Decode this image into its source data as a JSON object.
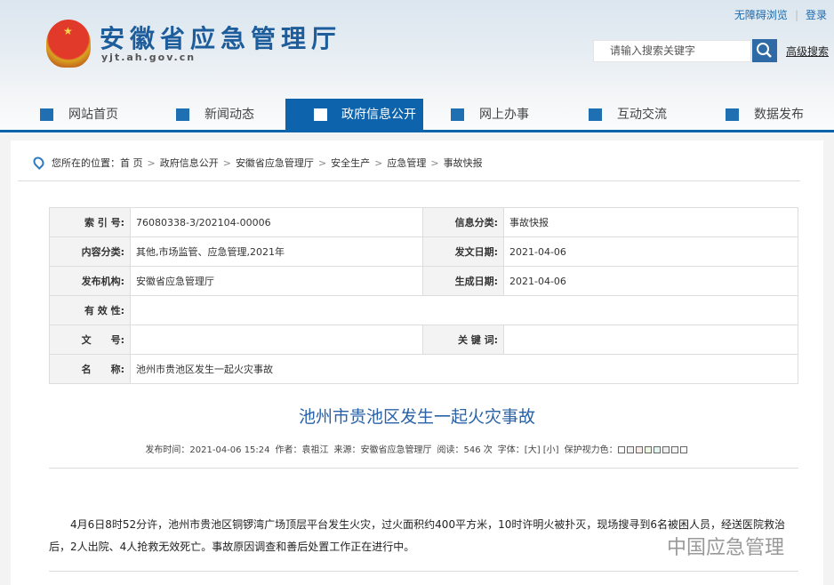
{
  "header": {
    "site_title": "安徽省应急管理厅",
    "site_url": "yjt.ah.gov.cn",
    "links": [
      "无障碍浏览",
      "登录"
    ],
    "search_placeholder": "请输入搜索关键字",
    "advanced_search": "高级搜索"
  },
  "nav": [
    {
      "label": "网站首页",
      "icon": "home-icon"
    },
    {
      "label": "新闻动态",
      "icon": "news-icon"
    },
    {
      "label": "政府信息公开",
      "icon": "document-icon",
      "active": true
    },
    {
      "label": "网上办事",
      "icon": "monitor-icon"
    },
    {
      "label": "互动交流",
      "icon": "chat-icon"
    },
    {
      "label": "数据发布",
      "icon": "chart-icon"
    }
  ],
  "breadcrumb": {
    "prefix": "您所在的位置：",
    "items": [
      "首 页",
      "政府信息公开",
      "安徽省应急管理厅",
      "安全生产",
      "应急管理",
      "事故快报"
    ]
  },
  "info": {
    "index_label": "索 引 号:",
    "index": "76080338-3/202104-00006",
    "category_label": "信息分类:",
    "category": "事故快报",
    "content_label": "内容分类:",
    "content": "其他,市场监管、应急管理,2021年",
    "date_label": "发文日期:",
    "date": "2021-04-06",
    "org_label": "发布机构:",
    "org": "安徽省应急管理厅",
    "gen_label": "生成日期:",
    "gen": "2021-04-06",
    "valid_label": "有 效 性:",
    "valid": "",
    "doc_label": "文　　号:",
    "doc": "",
    "kw_label": "关 键 词:",
    "kw": "",
    "name_label": "名　　称:",
    "name": "池州市贵池区发生一起火灾事故"
  },
  "article": {
    "title": "池州市贵池区发生一起火灾事故",
    "published": "发布时间：2021-04-06 15:24",
    "author": "作者：袁祖江",
    "source": "来源：安徽省应急管理厅",
    "reads": "阅读：546 次",
    "font": "字体：[大] [小]",
    "eye": "保护视力色：",
    "body": "4月6日8时52分许，池州市贵池区铜锣湾广场顶层平台发生火灾，过火面积约400平方米，10时许明火被扑灭，现场搜寻到6名被困人员，经送医院救治后，2人出院、4人抢救无效死亡。事故原因调查和善后处置工作正在进行中。",
    "watermark": "中国应急管理"
  },
  "eye_colors": [
    "#ffffff",
    "#f0f0f0",
    "#fbe9e7",
    "#eef7e0",
    "#e2f5f0",
    "#eeeeee",
    "#f5f5f5",
    "#ffffff"
  ]
}
